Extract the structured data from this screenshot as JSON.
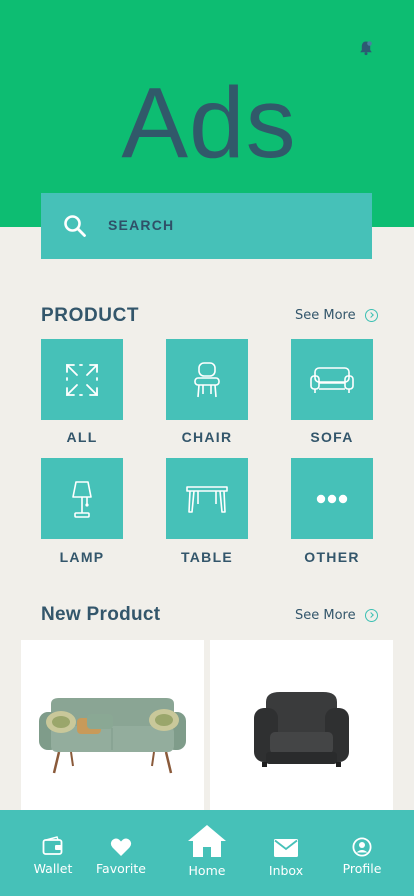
{
  "header": {
    "title": "Ads",
    "bell_icon": "bell-icon",
    "background_color": "#0dbd72"
  },
  "search": {
    "placeholder": "SEARCH",
    "icon": "search-icon"
  },
  "product_section": {
    "title": "PRODUCT",
    "see_more": "See More",
    "categories": [
      {
        "label": "ALL",
        "icon": "expand-arrows-icon"
      },
      {
        "label": "CHAIR",
        "icon": "chair-icon"
      },
      {
        "label": "SOFA",
        "icon": "sofa-icon"
      },
      {
        "label": "LAMP",
        "icon": "lamp-icon"
      },
      {
        "label": "TABLE",
        "icon": "table-icon"
      },
      {
        "label": "OTHER",
        "icon": "more-dots-icon"
      }
    ]
  },
  "new_product_section": {
    "title": "New Product",
    "see_more": "See More",
    "products": [
      {
        "image": "green-sofa-image"
      },
      {
        "image": "black-armchair-image"
      }
    ]
  },
  "bottom_nav": {
    "items": [
      {
        "label": "Wallet",
        "icon": "wallet-icon"
      },
      {
        "label": "Favorite",
        "icon": "heart-icon"
      },
      {
        "label": "Home",
        "icon": "home-icon",
        "active": true
      },
      {
        "label": "Inbox",
        "icon": "mail-icon"
      },
      {
        "label": "Profile",
        "icon": "user-circle-icon"
      }
    ]
  },
  "colors": {
    "accent": "#46c1b8",
    "text": "#33566b",
    "background": "#f1efea"
  }
}
